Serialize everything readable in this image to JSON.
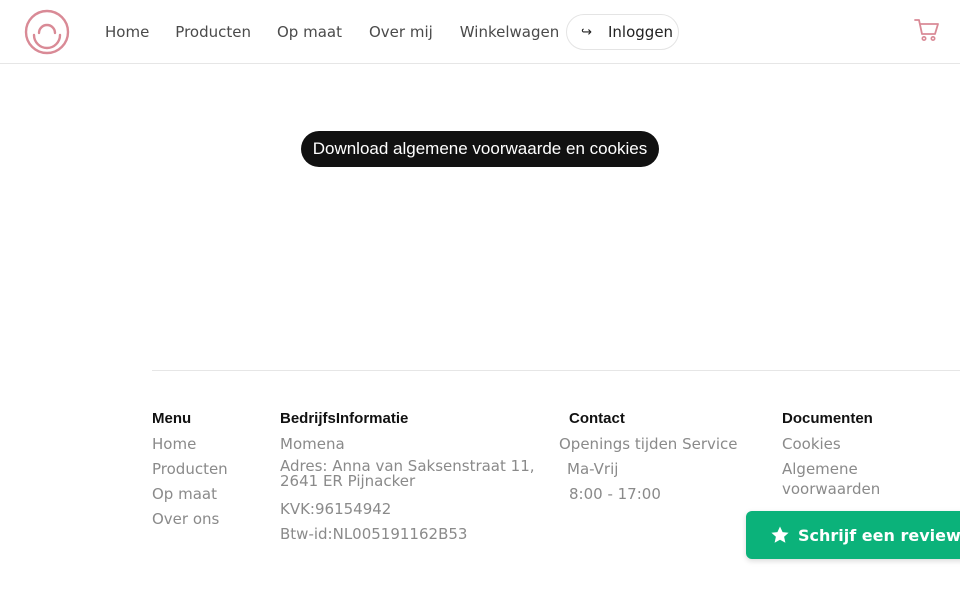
{
  "header": {
    "nav": [
      "Home",
      "Producten",
      "Op maat",
      "Over mij",
      "Winkelwagen"
    ],
    "login_label": "Inloggen",
    "login_icon": "↪"
  },
  "main": {
    "download_label": "Download algemene voorwaarde en cookies"
  },
  "footer": {
    "menu": {
      "title": "Menu",
      "items": [
        "Home",
        "Producten",
        "Op maat",
        "Over ons"
      ]
    },
    "company": {
      "title": "BedrijfsInformatie",
      "name": "Momena",
      "address_line1": "Adres: Anna van Saksenstraat 11,",
      "address_line2": "2641 ER Pijnacker",
      "kvk": "KVK:96154942",
      "btw": "Btw-id:NL005191162B53"
    },
    "contact": {
      "title": "Contact",
      "hours_label": "Openings tijden Service",
      "days": "Ma-Vrij",
      "hours": "8:00 - 17:00"
    },
    "documents": {
      "title": "Documenten",
      "items": [
        "Cookies",
        "Algemene voorwaarden"
      ]
    }
  },
  "review": {
    "label": "Schrijf een review"
  },
  "colors": {
    "brand": "#d98a96",
    "button_dark": "#111111",
    "review_green": "#0bb27a"
  }
}
